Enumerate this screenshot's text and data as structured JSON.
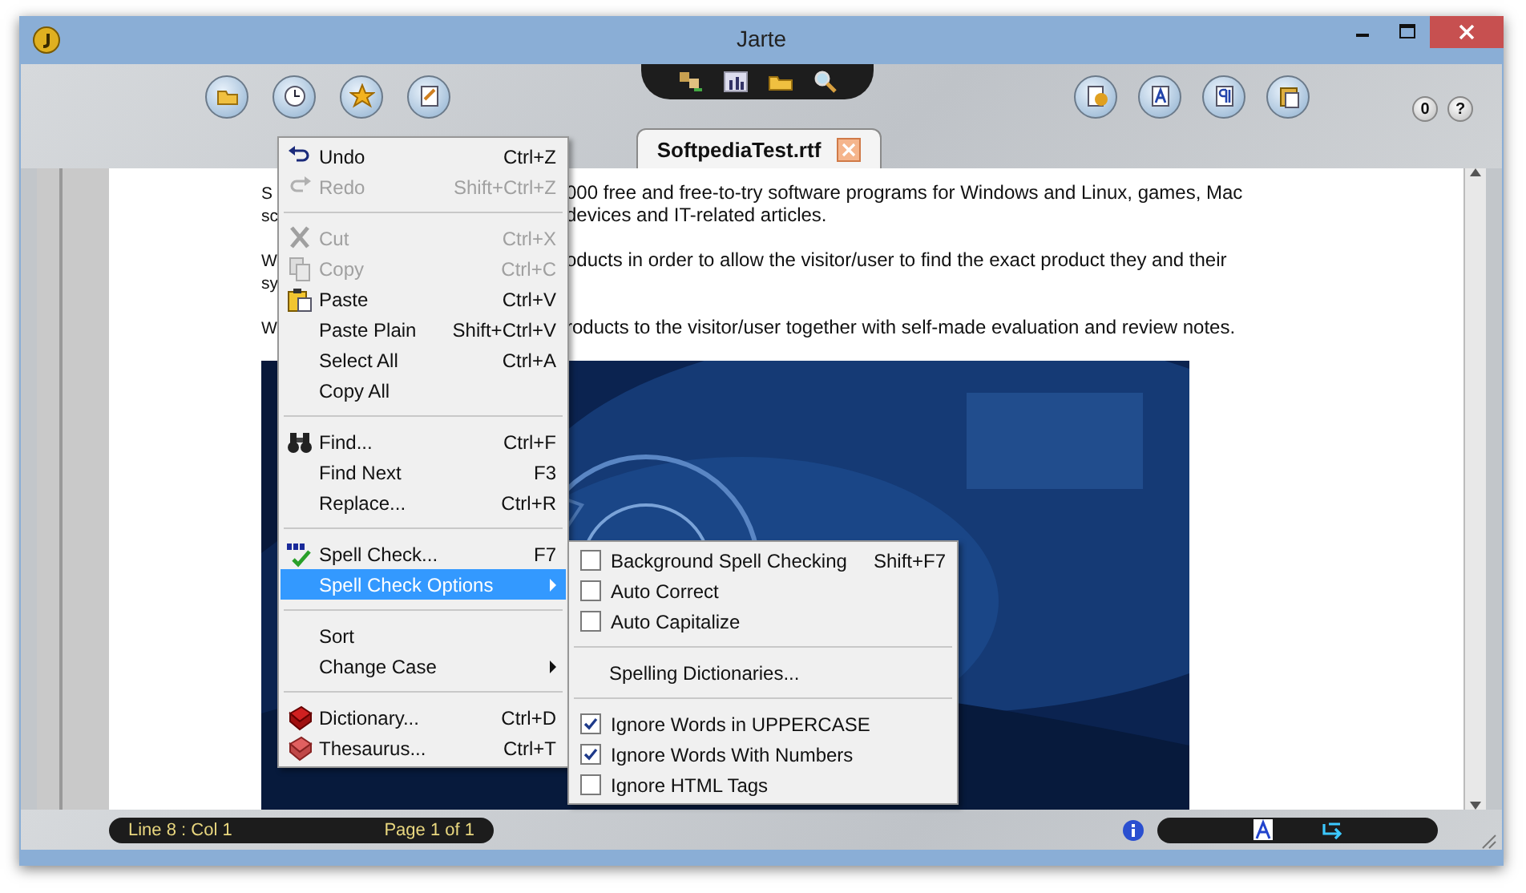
{
  "window": {
    "title": "Jarte"
  },
  "toolbar": {
    "small_buttons": [
      "0",
      "?"
    ]
  },
  "tabs": [
    {
      "label": "SoftpediaTest.rtf",
      "selected": true
    }
  ],
  "document": {
    "lines": [
      {
        "left": "S",
        "right": "000 free and free-to-try software programs for Windows and Linux, games, Mac"
      },
      {
        "left": "sc",
        "right": "devices and IT-related articles."
      },
      {
        "left": "W",
        "right": "oducts in order to allow the visitor/user to find the exact product they and their",
        "gap_before": true
      },
      {
        "left": "sy"
      },
      {
        "left": "W",
        "right": "roducts to the visitor/user together with self-made evaluation and review notes.",
        "gap_before": true
      }
    ]
  },
  "context_menu": {
    "items": [
      {
        "kind": "item",
        "label": "Undo",
        "shortcut": "Ctrl+Z",
        "disabled": false,
        "selected": false,
        "submenu": false
      },
      {
        "kind": "item",
        "label": "Redo",
        "shortcut": "Shift+Ctrl+Z",
        "disabled": true,
        "selected": false,
        "submenu": false
      },
      {
        "kind": "separator"
      },
      {
        "kind": "item",
        "label": "Cut",
        "shortcut": "Ctrl+X",
        "disabled": true,
        "selected": false,
        "submenu": false
      },
      {
        "kind": "item",
        "label": "Copy",
        "shortcut": "Ctrl+C",
        "disabled": true,
        "selected": false,
        "submenu": false
      },
      {
        "kind": "item",
        "label": "Paste",
        "shortcut": "Ctrl+V",
        "disabled": false,
        "selected": false,
        "submenu": false
      },
      {
        "kind": "item",
        "label": "Paste Plain",
        "shortcut": "Shift+Ctrl+V",
        "disabled": false,
        "selected": false,
        "submenu": false
      },
      {
        "kind": "item",
        "label": "Select All",
        "shortcut": "Ctrl+A",
        "disabled": false,
        "selected": false,
        "submenu": false
      },
      {
        "kind": "item",
        "label": "Copy All",
        "disabled": false,
        "selected": false,
        "submenu": false
      },
      {
        "kind": "separator"
      },
      {
        "kind": "item",
        "label": "Find...",
        "shortcut": "Ctrl+F",
        "disabled": false,
        "selected": false,
        "submenu": false
      },
      {
        "kind": "item",
        "label": "Find Next",
        "shortcut": "F3",
        "disabled": false,
        "selected": false,
        "submenu": false
      },
      {
        "kind": "item",
        "label": "Replace...",
        "shortcut": "Ctrl+R",
        "disabled": false,
        "selected": false,
        "submenu": false
      },
      {
        "kind": "separator"
      },
      {
        "kind": "item",
        "label": "Spell Check...",
        "shortcut": "F7",
        "disabled": false,
        "selected": false,
        "submenu": false
      },
      {
        "kind": "item",
        "label": "Spell Check Options",
        "disabled": false,
        "selected": true,
        "submenu": true
      },
      {
        "kind": "separator"
      },
      {
        "kind": "item",
        "label": "Sort",
        "disabled": false,
        "selected": false,
        "submenu": false
      },
      {
        "kind": "item",
        "label": "Change Case",
        "disabled": false,
        "selected": false,
        "submenu": true
      },
      {
        "kind": "separator"
      },
      {
        "kind": "item",
        "label": "Dictionary...",
        "shortcut": "Ctrl+D",
        "disabled": false,
        "selected": false,
        "submenu": false
      },
      {
        "kind": "item",
        "label": "Thesaurus...",
        "shortcut": "Ctrl+T",
        "disabled": false,
        "selected": false,
        "submenu": false
      }
    ]
  },
  "submenu": {
    "items": [
      {
        "kind": "checkbox",
        "label": "Background Spell Checking",
        "shortcut": "Shift+F7",
        "checked": false
      },
      {
        "kind": "checkbox",
        "label": "Auto Correct",
        "checked": false
      },
      {
        "kind": "checkbox",
        "label": "Auto Capitalize",
        "checked": false
      },
      {
        "kind": "separator"
      },
      {
        "kind": "item",
        "label": "Spelling Dictionaries..."
      },
      {
        "kind": "separator"
      },
      {
        "kind": "checkbox",
        "label": "Ignore Words in UPPERCASE",
        "checked": true
      },
      {
        "kind": "checkbox",
        "label": "Ignore Words With Numbers",
        "checked": true
      },
      {
        "kind": "checkbox",
        "label": "Ignore HTML Tags",
        "checked": false
      }
    ]
  },
  "status_bar": {
    "position": "Line 8 : Col 1",
    "page": "Page 1 of 1"
  }
}
